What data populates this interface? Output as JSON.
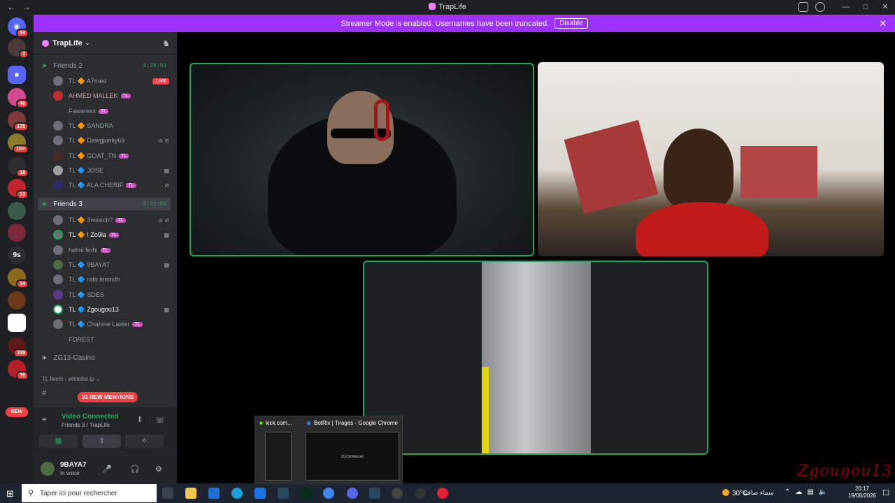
{
  "window": {
    "title": "TrapLife",
    "back": "←",
    "forward": "→"
  },
  "banner": {
    "text": "Streamer Mode is enabled. Usernames have been truncated.",
    "disable_label": "Disable"
  },
  "rail": {
    "badges": [
      "94",
      "2",
      "40",
      "175",
      "1K+",
      "18",
      "33",
      "9s",
      "14",
      "235",
      "76"
    ],
    "new_label": "NEW"
  },
  "guild": {
    "name": "TrapLife"
  },
  "channels": {
    "friends2": {
      "name": "Friends 2",
      "timer": "3:29:03"
    },
    "friends2_members": [
      {
        "name": "TL 🔶 A7med",
        "live": "LIVE"
      },
      {
        "name": "AHMED MALLEK",
        "tag": "TL"
      },
      {
        "name": "Fawaress",
        "tag": "TL"
      },
      {
        "name": "TL 🔶 SANDRA"
      },
      {
        "name": "TL 🔶 Dawgjunky69"
      },
      {
        "name": "TL 🔶 GOAT_TN",
        "tag": "TL"
      },
      {
        "name": "TL 🔷 JOSE"
      },
      {
        "name": "TL 🔷 ALA CHERIF",
        "tag": "TL"
      }
    ],
    "friends3": {
      "name": "Friends 3",
      "timer": "3:31:56"
    },
    "friends3_members": [
      {
        "name": "TL 🔶 3mirech?",
        "tag": "TL"
      },
      {
        "name": "TL 🔶 ! Zo9la",
        "tag": "TL"
      },
      {
        "name": "helmi ferhi",
        "tag": "TL"
      },
      {
        "name": "TL 🔷 9BAYA7"
      },
      {
        "name": "TL 🔷 rafa lemridh"
      },
      {
        "name": "TL 🔷 SDES"
      },
      {
        "name": "TL 🔷 Zgougou13"
      },
      {
        "name": "TL 🔷 Chahine Laster",
        "tag": "TL"
      },
      {
        "name": "FOREST"
      }
    ],
    "zg13": {
      "name": "ZG13-Casino"
    },
    "category": {
      "name": "TL fivem - whitelist ip"
    },
    "mentions": "31 NEW MENTIONS"
  },
  "voice": {
    "status": "Video Connected",
    "location": "Friends 3 / TrapLife"
  },
  "user": {
    "name": "9BAYA7",
    "status": "In voice"
  },
  "thumbs": {
    "t1": "kick.com...",
    "t2": "BotRix | Tirages - Google Chrome",
    "t2_preview": "ZG13xMassan"
  },
  "watermark": "Zgougou13",
  "taskbar": {
    "search_placeholder": "Taper ici pour rechercher",
    "weather_temp": "30°C",
    "weather_text": "سماء صافية",
    "time": "20:17",
    "date": "19/08/2026"
  },
  "colors": {
    "accent": "#9c32ff",
    "speaking": "#23a55a",
    "live": "#ed4245"
  }
}
